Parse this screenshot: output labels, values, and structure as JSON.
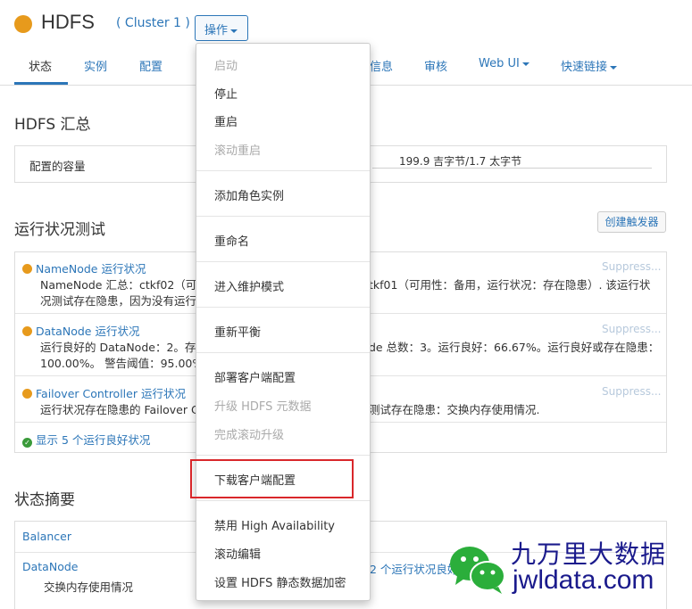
{
  "header": {
    "title": "HDFS",
    "cluster": "( Cluster 1 )",
    "ops_label": "操作"
  },
  "tabs": [
    {
      "label": "状态"
    },
    {
      "label": "实例"
    },
    {
      "label": "配置"
    },
    {
      "label": "信息"
    },
    {
      "label": "审核"
    },
    {
      "label": "Web UI"
    },
    {
      "label": "快速链接"
    }
  ],
  "summary": {
    "title": "HDFS 汇总",
    "capacity_label": "配置的容量",
    "capacity_value": "199.9 吉字节/1.7 太字节"
  },
  "health": {
    "title": "运行状况测试",
    "create_trigger": "创建触发器",
    "items": [
      {
        "name": "NameNode 运行状况",
        "line1_a": "NameNode 汇总：ctkf02（可",
        "line1_b": "tkf01（可用性：备用，运行状况：存在隐患）. 该运行状",
        "line2": "况测试存在隐患，因为没有运行",
        "suppress": "Suppress..."
      },
      {
        "name": "DataNode 运行状况",
        "line1_a": "运行良好的 DataNode：2。存",
        "line1_b": "de 总数：3。运行良好：66.67%。运行良好或存在隐患：",
        "line2": "100.00%。 警告阈值：95.00%",
        "suppress": "Suppress..."
      },
      {
        "name": "Failover Controller 运行状况",
        "line1_a": "运行状况存在隐患的 Failover C",
        "line1_b": "测试存在隐患：交换内存使用情况.",
        "suppress": "Suppress..."
      }
    ],
    "show_good": "显示 5 个运行良好状况"
  },
  "status_summary": {
    "title": "状态摘要",
    "rows": [
      {
        "name": "Balancer"
      },
      {
        "name": "DataNode",
        "sub": "交换内存使用情况",
        "right": "2 个运行状况良好"
      }
    ]
  },
  "menu": {
    "items": [
      {
        "label": "启动",
        "disabled": true
      },
      {
        "label": "停止"
      },
      {
        "label": "重启"
      },
      {
        "label": "滚动重启",
        "disabled": true
      },
      {
        "label": "添加角色实例"
      },
      {
        "label": "重命名"
      },
      {
        "label": "进入维护模式"
      },
      {
        "label": "重新平衡"
      },
      {
        "label": "部署客户端配置"
      },
      {
        "label": "升级 HDFS 元数据",
        "disabled": true
      },
      {
        "label": "完成滚动升级",
        "disabled": true
      },
      {
        "label": "下载客户端配置"
      },
      {
        "label": "禁用 High Availability"
      },
      {
        "label": "滚动编辑"
      },
      {
        "label": "设置 HDFS 静态数据加密"
      }
    ]
  },
  "watermark": {
    "cn": "九万里大数据",
    "en": "jwldata.com"
  },
  "colors": {
    "accent": "#2c76b8",
    "warning": "#e79a1c",
    "highlight": "#d9272b"
  }
}
